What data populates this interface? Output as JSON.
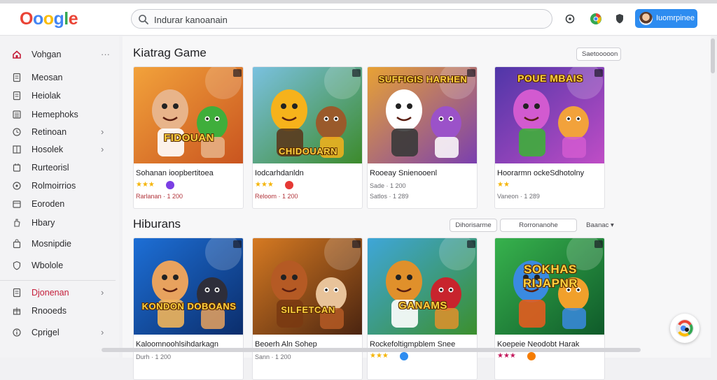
{
  "header": {
    "logo": "Ooogle",
    "search_value": "Indurar kanoanain",
    "sign_in_label": "Iuomrpinee"
  },
  "sidebar": {
    "items": [
      {
        "label": "Vohgan",
        "icon": "home-icon",
        "active": false,
        "chevron": false,
        "more": true
      },
      {
        "label": "Meosan",
        "icon": "page-icon",
        "chevron": false
      },
      {
        "label": "Heiolak",
        "icon": "page-icon",
        "chevron": false
      },
      {
        "label": "Hemephoks",
        "icon": "list-icon",
        "chevron": false
      },
      {
        "label": "Retinoan",
        "icon": "clock-icon",
        "chevron": true
      },
      {
        "label": "Hosolek",
        "icon": "grid-icon",
        "chevron": true
      },
      {
        "label": "Rurteorisl",
        "icon": "cart-icon",
        "chevron": false
      },
      {
        "label": "Rolmoirrios",
        "icon": "circle-icon",
        "chevron": false
      },
      {
        "label": "Eoroden",
        "icon": "folder-icon",
        "chevron": false
      },
      {
        "label": "Hbary",
        "icon": "hand-icon",
        "chevron": false
      },
      {
        "label": "Mosnipdie",
        "icon": "bag-icon",
        "chevron": false
      },
      {
        "label": "Wbolole",
        "icon": "shield-icon",
        "chevron": false
      },
      {
        "label": "Djonenan",
        "icon": "page-icon",
        "active": true,
        "chevron": true
      },
      {
        "label": "Rnooeds",
        "icon": "gift-icon",
        "chevron": false
      },
      {
        "label": "Cprigel",
        "icon": "info-icon",
        "chevron": true
      }
    ],
    "more_label": "···",
    "chevron_glyph": "›"
  },
  "sections": [
    {
      "title": "Kiatrag Game",
      "controls": [
        "Saetooooon"
      ],
      "cards": [
        {
          "title": "Sohanan ioopbertitoea",
          "thumb_text": "FIDOUAN",
          "stars": "★★★",
          "meta": "Rarlanan · 1 200",
          "meta_red": true,
          "badge_color": "#7b3fe4"
        },
        {
          "title": "Iodcarhdanldn",
          "thumb_text": "CHIDOUARN",
          "stars": "★★★",
          "meta": "Reloom · 1 200",
          "meta_red": true,
          "badge_color": "#e53935"
        },
        {
          "title": "Rooeay Snienooenl",
          "thumb_text": "SUFFIGIS HARHEN",
          "stars": "",
          "meta": "Sade · 1 200",
          "meta_red": false,
          "badge_color": "",
          "meta2": "Satlos · 1 289"
        },
        {
          "title": "Hoorarmn ockeSdhotolny",
          "thumb_text": "POUE MBAIS",
          "stars": "★★",
          "meta": "Vaneon · 1 289",
          "meta_red": false,
          "badge_color": ""
        }
      ]
    },
    {
      "title": "Hiburans",
      "controls": [
        "Dihorisarme",
        "Rorronanohe",
        "Baanac ▾"
      ],
      "cards": [
        {
          "title": "Kaloomnoohlsihdarkagn",
          "thumb_text": "KONDON DOBOANS",
          "stars": "",
          "meta": "Durh · 1 200",
          "meta_red": false,
          "badge_color": ""
        },
        {
          "title": "Beoerh Aln Sohep",
          "thumb_text": "SILFETCAN",
          "stars": "",
          "meta": "Sann · 1 200",
          "meta_red": false,
          "badge_color": ""
        },
        {
          "title": "Rockefoltigmpblem Snee",
          "thumb_text": "GANAMS",
          "stars": "★★★",
          "meta": "",
          "meta_red": false,
          "badge_color": "#2d8cf0"
        },
        {
          "title": "Koepeie Neodobt Harak",
          "thumb_text": "SOKHAS RIJAPNR",
          "stars": "★★★",
          "meta": "",
          "meta_red": false,
          "badge_color": "#f57c00"
        }
      ]
    }
  ],
  "colors": {
    "accent": "#2d8cf0",
    "active_nav": "#c41e3a",
    "star": "#f5b400"
  }
}
